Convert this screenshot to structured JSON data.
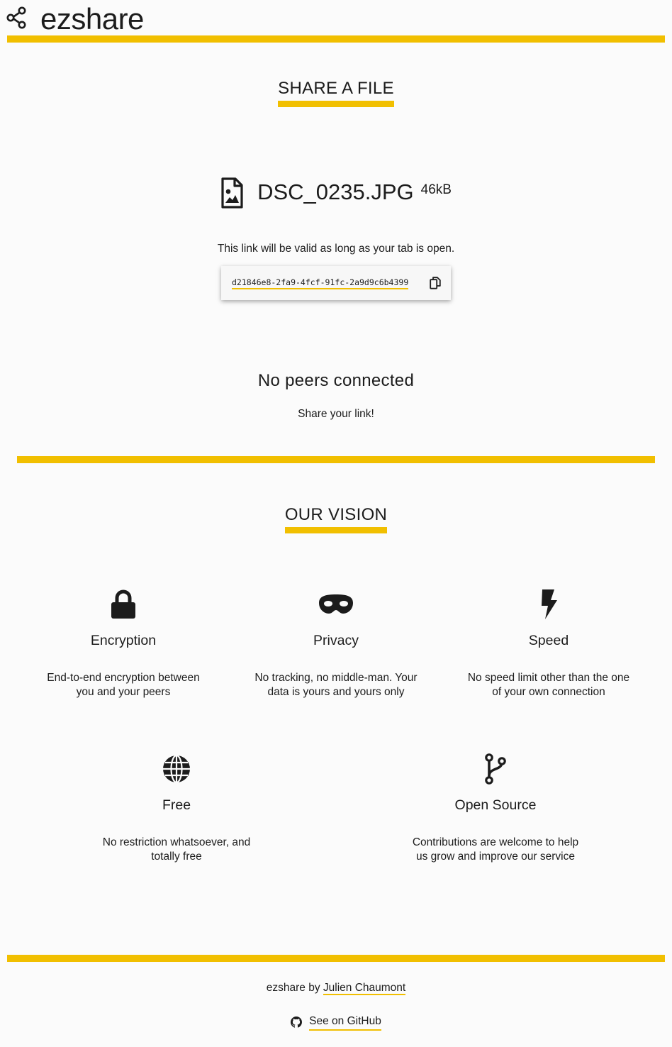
{
  "header": {
    "brand": "ezshare",
    "logo_icon": "share-nodes-icon"
  },
  "share": {
    "title": "SHARE A FILE",
    "file_icon": "file-image-icon",
    "file_name": "DSC_0235.JPG",
    "file_size": "46kB",
    "validity_text": "This link will be valid as long as your tab is open.",
    "link": "d21846e8-2fa9-4fcf-91fc-2a9d9c6b4399",
    "copy_icon": "copy-icon"
  },
  "peers": {
    "title": "No peers connected",
    "subtitle": "Share your link!"
  },
  "vision": {
    "title": "OUR VISION",
    "features": [
      {
        "icon": "lock-icon",
        "title": "Encryption",
        "desc_line1": "End-to-end encryption between",
        "desc_line2": "you and your peers"
      },
      {
        "icon": "mask-icon",
        "title": "Privacy",
        "desc_line1": "No tracking, no middle-man. Your",
        "desc_line2": "data is yours and yours only"
      },
      {
        "icon": "bolt-icon",
        "title": "Speed",
        "desc_line1": "No speed limit other than the one",
        "desc_line2": "of your own connection"
      },
      {
        "icon": "globe-icon",
        "title": "Free",
        "desc_line1": "No restriction whatsoever, and",
        "desc_line2": "totally free"
      },
      {
        "icon": "code-branch-icon",
        "title": "Open Source",
        "desc_line1": "Contributions are welcome to help",
        "desc_line2": "us grow and improve our service"
      }
    ]
  },
  "footer": {
    "credit_prefix": "ezshare by",
    "author": "Julien Chaumont",
    "github_label": "See on GitHub",
    "github_icon": "github-icon"
  },
  "colors": {
    "accent": "#f1bf00",
    "text": "#1c1c1c",
    "background": "#fbfbfb"
  }
}
